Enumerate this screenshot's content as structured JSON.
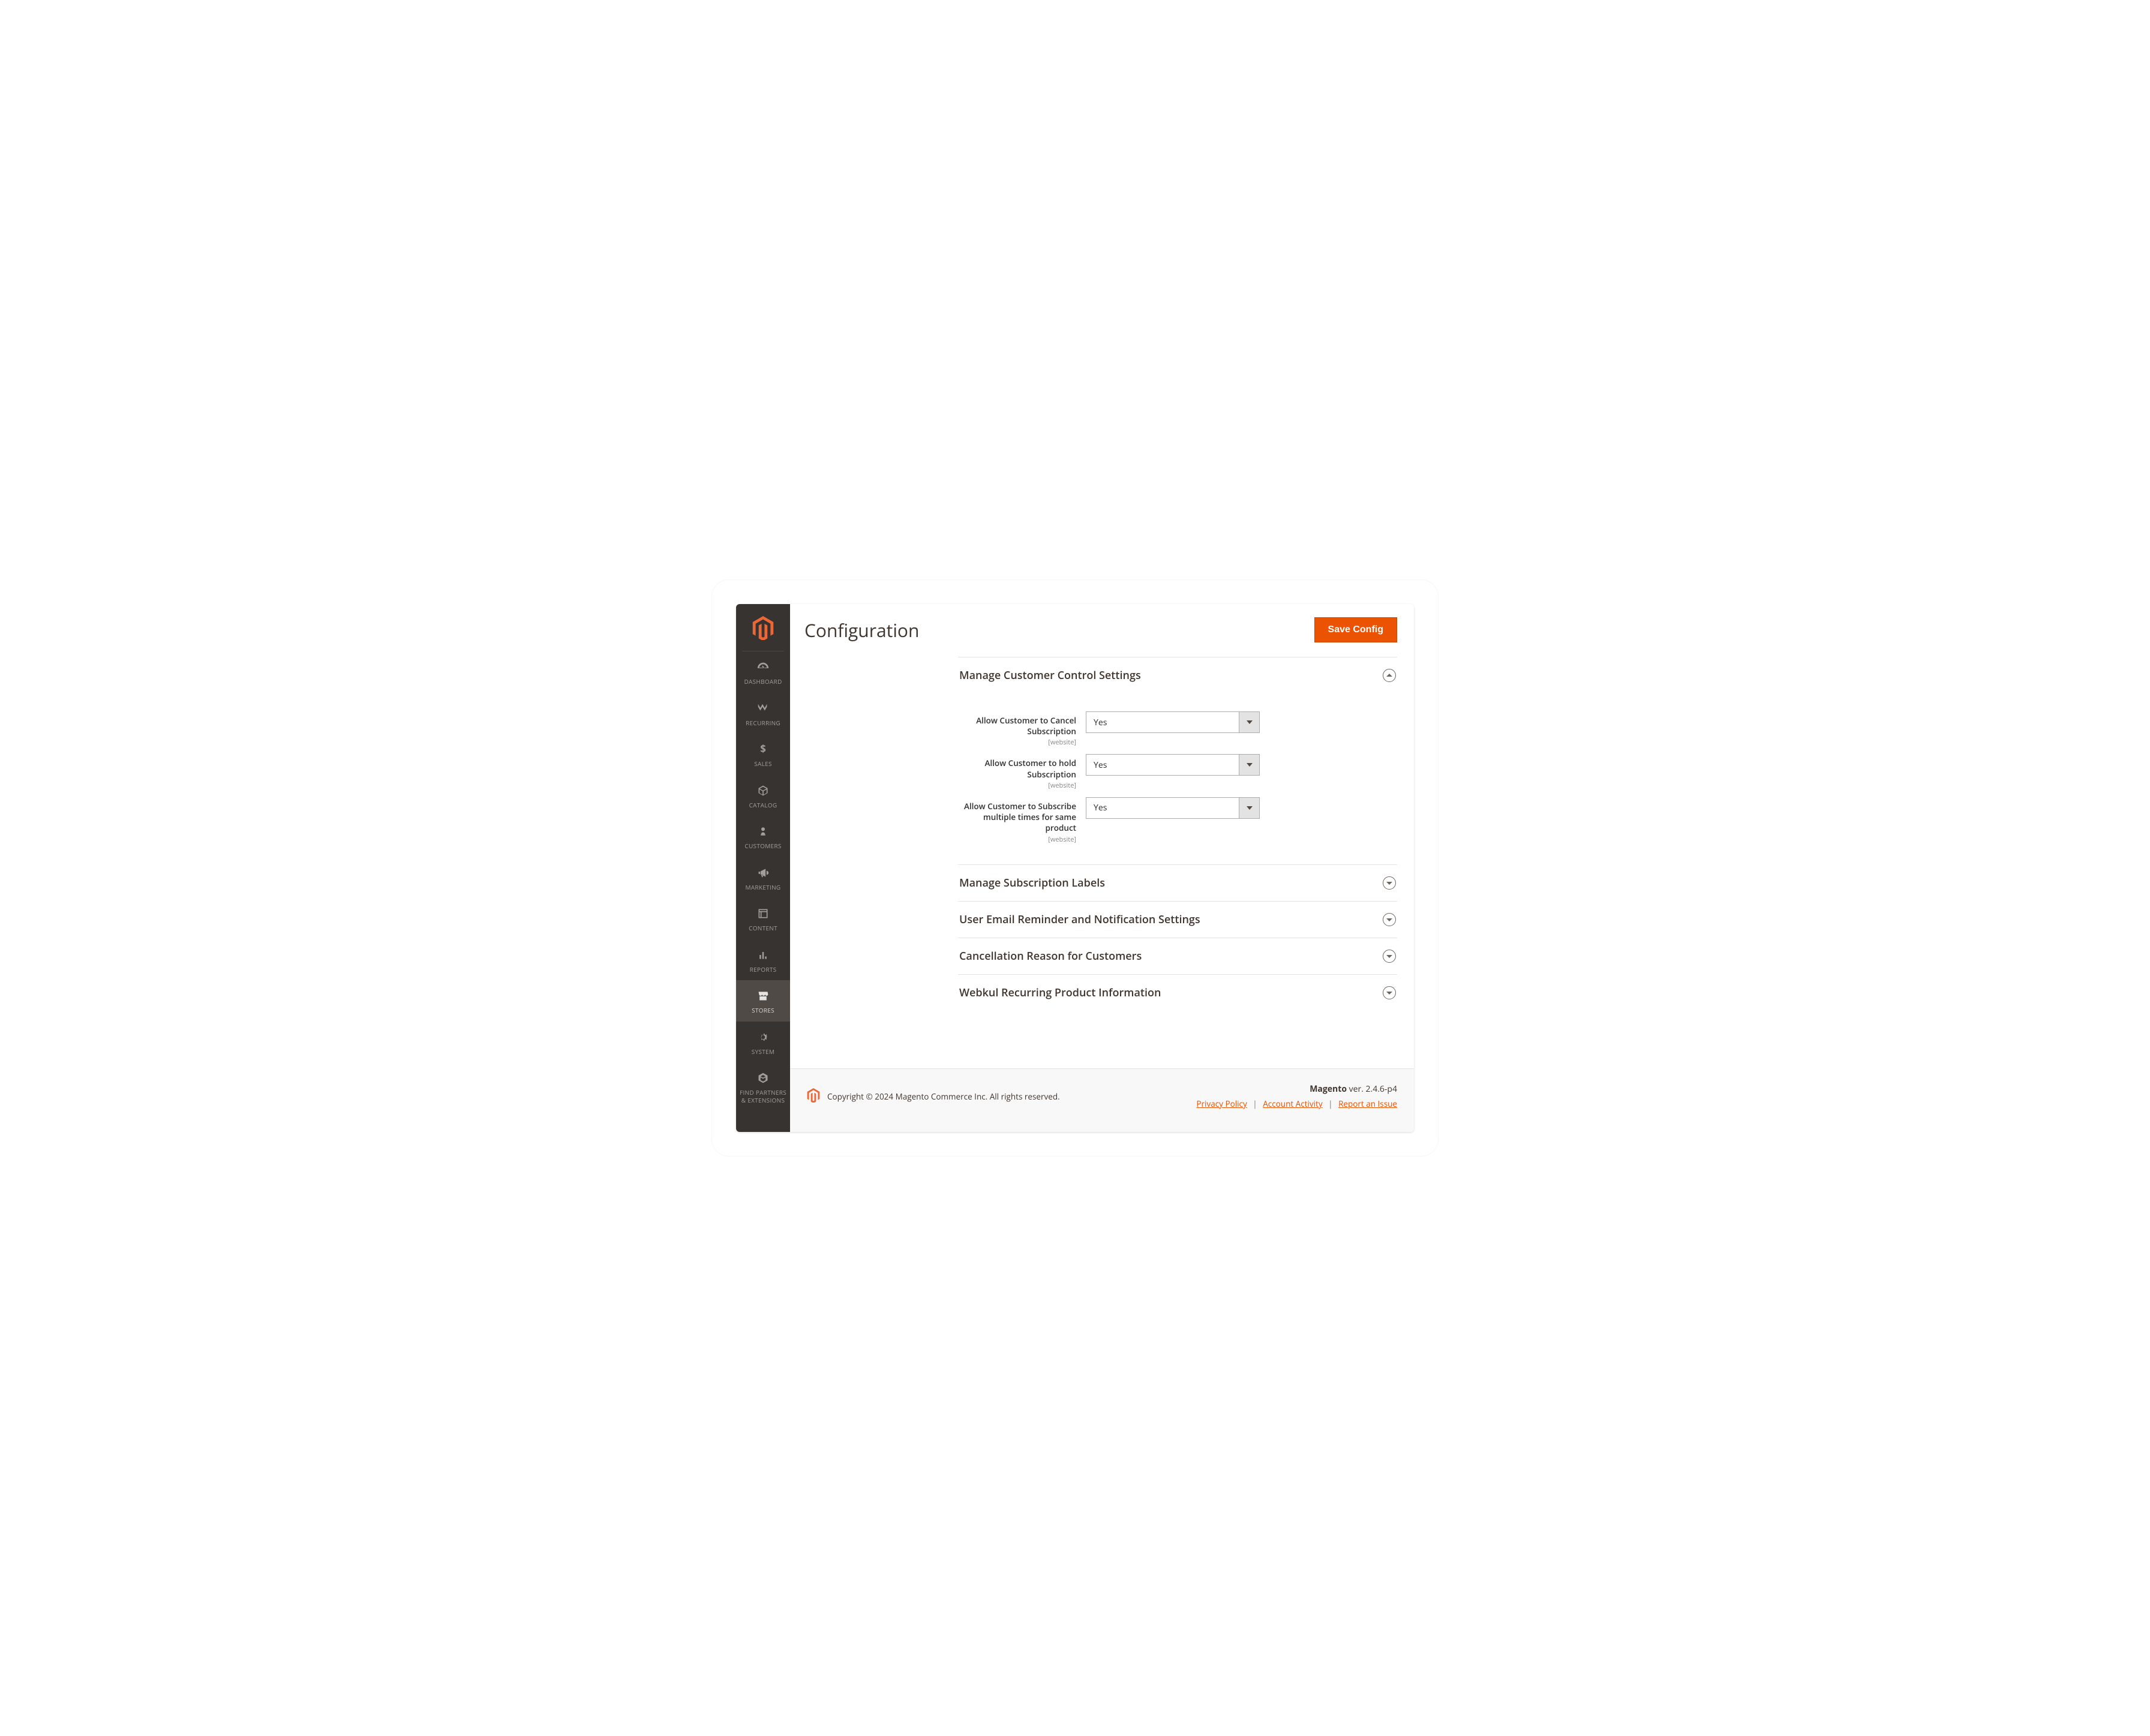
{
  "header": {
    "page_title": "Configuration",
    "save_button": "Save Config"
  },
  "sidebar": {
    "items": [
      {
        "label": "DASHBOARD"
      },
      {
        "label": "RECURRING"
      },
      {
        "label": "SALES"
      },
      {
        "label": "CATALOG"
      },
      {
        "label": "CUSTOMERS"
      },
      {
        "label": "MARKETING"
      },
      {
        "label": "CONTENT"
      },
      {
        "label": "REPORTS"
      },
      {
        "label": "STORES"
      },
      {
        "label": "SYSTEM"
      },
      {
        "label": "FIND PARTNERS & EXTENSIONS"
      }
    ]
  },
  "sections": [
    {
      "title": "Manage Customer Control Settings",
      "expanded": true,
      "fields": [
        {
          "label": "Allow Customer to Cancel Subscription",
          "scope": "[website]",
          "value": "Yes"
        },
        {
          "label": "Allow Customer to hold Subscription",
          "scope": "[website]",
          "value": "Yes"
        },
        {
          "label": "Allow Customer to Subscribe multiple times for same product",
          "scope": "[website]",
          "value": "Yes"
        }
      ]
    },
    {
      "title": "Manage Subscription Labels",
      "expanded": false
    },
    {
      "title": "User Email Reminder and Notification Settings",
      "expanded": false
    },
    {
      "title": "Cancellation Reason for Customers",
      "expanded": false
    },
    {
      "title": "Webkul Recurring Product Information",
      "expanded": false
    }
  ],
  "footer": {
    "copyright": "Copyright © 2024 Magento Commerce Inc. All rights reserved.",
    "product": "Magento",
    "version": "ver. 2.4.6-p4",
    "links": {
      "privacy": "Privacy Policy",
      "activity": " Account Activity",
      "report": "Report an Issue"
    }
  }
}
